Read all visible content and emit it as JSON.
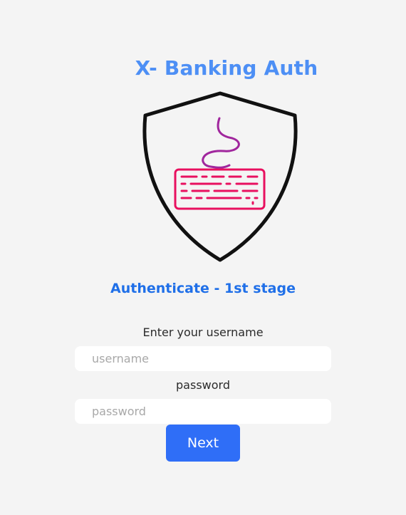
{
  "header": {
    "title": "X- Banking Auth"
  },
  "logo": {
    "icon": "shield-keyboard-icon",
    "shield_color": "#111111",
    "keyboard_color": "#e8105f",
    "cable_color": "#a0269d"
  },
  "stage": {
    "heading": "Authenticate - 1st stage"
  },
  "form": {
    "username_label": "Enter your username",
    "username_placeholder": "username",
    "username_value": "",
    "password_label": "password",
    "password_placeholder": "password",
    "password_value": "",
    "next_label": "Next"
  },
  "colors": {
    "background": "#f4f4f4",
    "title": "#4d8ff5",
    "heading": "#1f6fe8",
    "button": "#2f6ef7"
  }
}
